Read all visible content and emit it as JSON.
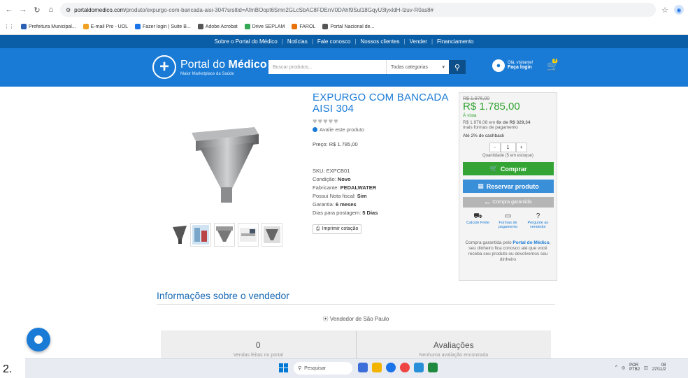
{
  "browser": {
    "url_host": "portaldomedico.com",
    "url_rest": "/produto/expurgo-com-bancada-aisi-304?srsltid=AfmBOopt6Smn2GLcSbAC8FDEnV0DAhf9Sul18GqyU3lyxldH-Izuv-R0as8#",
    "bookmarks": [
      {
        "label": "Prefeitura Municipal...",
        "color": "#2b5fb3"
      },
      {
        "label": "E-mail Pro - UOL",
        "color": "#f0a020"
      },
      {
        "label": "Fazer login | Suite B...",
        "color": "#1a73e8"
      },
      {
        "label": "Adobe Acrobat",
        "color": "#555"
      },
      {
        "label": "Drive SEPLAM",
        "color": "#34a853"
      },
      {
        "label": "FAROL",
        "color": "#e8710a"
      },
      {
        "label": "Portal Nacional de...",
        "color": "#555"
      }
    ]
  },
  "topnav": [
    "Sobre o Portal do Médico",
    "Notícias",
    "Fale conosco",
    "Nossos clientes",
    "Vender",
    "Financiamento"
  ],
  "header": {
    "logo_pre": "Portal do ",
    "logo_bold": "Médico",
    "logo_sub": "Maior Marketplace da Saúde",
    "search_placeholder": "Buscar produtos...",
    "category": "Todas categorias",
    "greeting": "Olá, visitante!",
    "login": "Faça login",
    "cart_count": "0"
  },
  "product": {
    "title": "EXPURGO COM BANCADA AISI 304",
    "rate_link": "Avalie este produto",
    "price_label": "Preço:",
    "price": "R$ 1.785,00",
    "specs": [
      {
        "label": "SKU:",
        "value": "EXPCB01",
        "bold": false
      },
      {
        "label": "Condição:",
        "value": "Novo",
        "bold": true
      },
      {
        "label": "Fabricante:",
        "value": "PEDALWATER",
        "bold": true
      },
      {
        "label": "Possui Nota fiscal:",
        "value": "Sim",
        "bold": true
      },
      {
        "label": "Garantia:",
        "value": "6 meses",
        "bold": true
      },
      {
        "label": "Dias para postagem:",
        "value": "5 Dias",
        "bold": true
      }
    ],
    "print_label": "Imprimir cotação"
  },
  "buybox": {
    "old_price": "R$ 1.976,00",
    "new_price": "R$ 1.785,00",
    "avista": "À vista",
    "install_pre": "R$ 1.976,08 em ",
    "install_bold": "6x de R$ 329,34",
    "install_more": "mais formas de pagamento",
    "cashback": "Até 2% de cashback",
    "qty_minus": "-",
    "qty_value": "1",
    "qty_plus": "+",
    "qty_note": "Quantidade (5 em estoque)",
    "buy": "Comprar",
    "reserve": "Reservar produto",
    "guarantee": "Compra garantida",
    "pay_items": [
      {
        "label": "Calcule Frete",
        "icon": "truck-icon",
        "glyph": "⛟"
      },
      {
        "label": "Formas de pagamento",
        "icon": "card-icon",
        "glyph": "▭"
      },
      {
        "label": "Pergunte ao vendedor",
        "icon": "question-icon",
        "glyph": "?"
      }
    ],
    "note_pre": "Compra garantida pelo ",
    "note_bold": "Portal do Médico",
    "note_post": ", seu dinheiro fica conosco até que você receba seu produto ou devolvemos seu dinheiro"
  },
  "vendor": {
    "title": "Informações sobre o vendedor",
    "location": "Vendedor de São Paulo",
    "stats": [
      {
        "value": "0",
        "sub": "Vendas feitas no portal"
      },
      {
        "value": "Avaliações",
        "sub": "Nenhuma avaliação encontrada"
      }
    ]
  },
  "taskbar": {
    "search": "Pesquisar",
    "lang_top": "POR",
    "lang_bottom": "PTB2",
    "time": "08",
    "date": "27/11/2"
  },
  "lead_number": "2."
}
